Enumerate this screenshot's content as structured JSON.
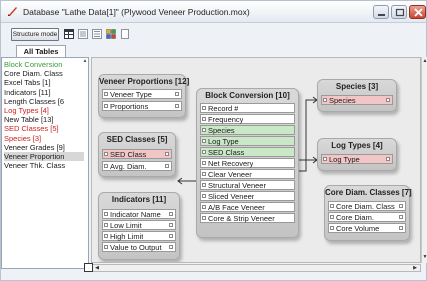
{
  "window": {
    "title": "Database \"Lathe Data[1]\" (Plywood Veneer Production.mox)"
  },
  "toolbar": {
    "mode_label": "Structure mode"
  },
  "tabs": [
    {
      "label": "All Tables"
    }
  ],
  "left_list": {
    "items": [
      {
        "label": "Block Conversion",
        "style": "green"
      },
      {
        "label": "Core Diam. Class",
        "style": "normal"
      },
      {
        "label": "Excel Tabs [1]",
        "style": "normal"
      },
      {
        "label": "Indicators [11]",
        "style": "normal"
      },
      {
        "label": "Length Classes [6",
        "style": "normal"
      },
      {
        "label": "Log Types [4]",
        "style": "red"
      },
      {
        "label": "New Table [13]",
        "style": "normal"
      },
      {
        "label": "SED Classes [5]",
        "style": "red"
      },
      {
        "label": "Species [3]",
        "style": "red"
      },
      {
        "label": "Veneer Grades [9]",
        "style": "normal"
      },
      {
        "label": "Veneer Proportion",
        "style": "selected"
      },
      {
        "label": "Veneer Thk. Class",
        "style": "normal"
      }
    ]
  },
  "tables": {
    "veneer_proportions": {
      "title": "Veneer Proportions [12]",
      "fields": [
        "Veneer Type",
        "Proportions"
      ]
    },
    "block_conversion": {
      "title": "Block Conversion [10]",
      "fields": [
        "Record #",
        "Frequency",
        "Species",
        "Log Type",
        "SED Class",
        "Net Recovery",
        "Clear Veneer",
        "Structural Veneer",
        "Sliced Veneer",
        "A/B Face Veneer",
        "Core & Strip Veneer"
      ]
    },
    "species": {
      "title": "Species [3]",
      "fields": [
        "Species"
      ]
    },
    "sed_classes": {
      "title": "SED Classes [5]",
      "fields": [
        "SED Class",
        "Avg. Diam."
      ]
    },
    "log_types": {
      "title": "Log Types [4]",
      "fields": [
        "Log Type"
      ]
    },
    "indicators": {
      "title": "Indicators [11]",
      "fields": [
        "Indicator Name",
        "Low Limit",
        "High Limit",
        "Value to Output"
      ]
    },
    "core_diam": {
      "title": "Core Diam. Classes [7]",
      "fields": [
        "Core Diam. Class",
        "Core Diam.",
        "Core Volume"
      ]
    }
  }
}
